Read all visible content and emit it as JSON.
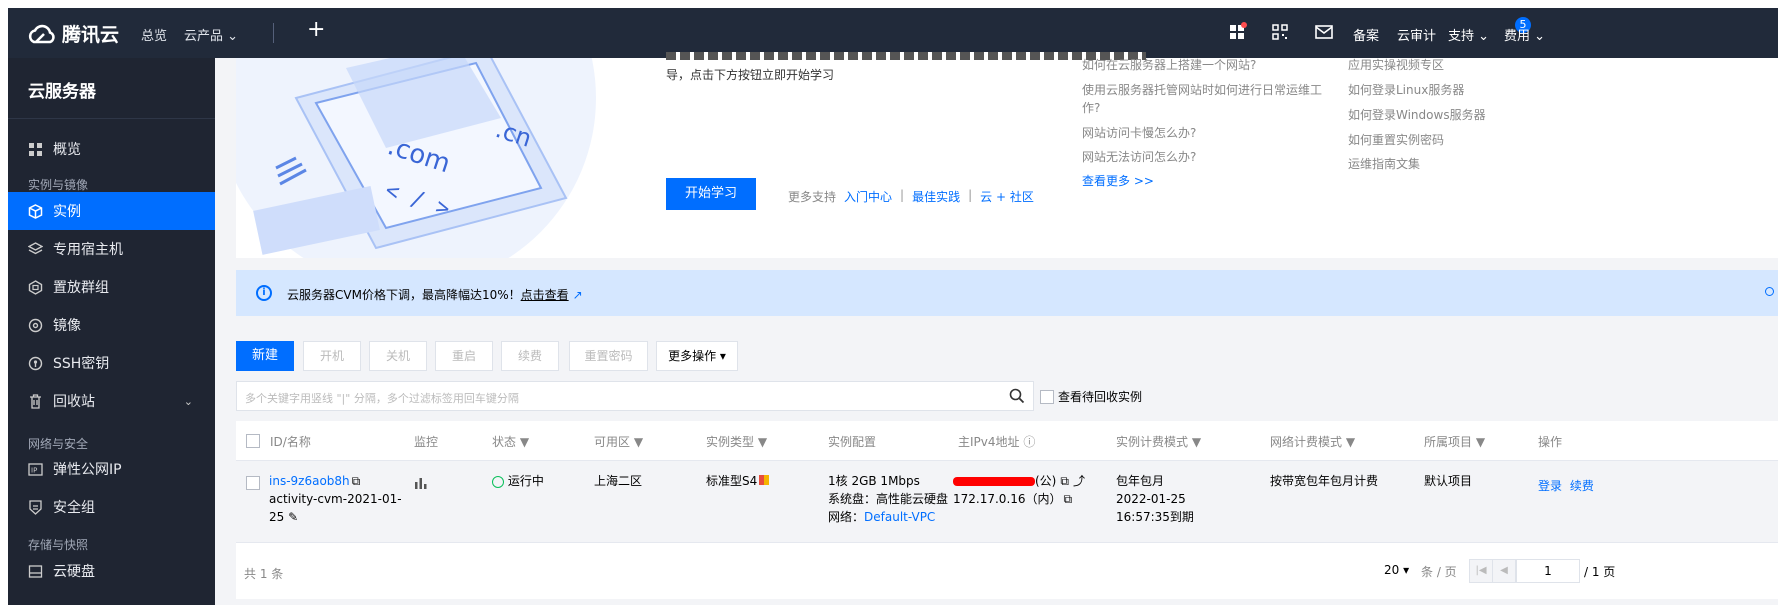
{
  "topnav": {
    "brand": "腾讯云",
    "overview": "总览",
    "products": "云产品",
    "products_caret": "⌄",
    "plus": "+",
    "message_badge": "5",
    "filing": "备案",
    "audit": "云审计",
    "support": "支持",
    "support_caret": "⌄",
    "billing": "费用",
    "billing_caret": "⌄"
  },
  "sidebar": {
    "title": "云服务器",
    "items": [
      {
        "label": "概览",
        "icon": "grid-icon"
      },
      {
        "label": "实例",
        "icon": "cube-icon"
      },
      {
        "label": "专用宿主机",
        "icon": "layers-icon"
      },
      {
        "label": "置放群组",
        "icon": "group-icon"
      },
      {
        "label": "镜像",
        "icon": "disc-icon"
      },
      {
        "label": "SSH密钥",
        "icon": "key-icon"
      },
      {
        "label": "回收站",
        "icon": "trash-icon"
      },
      {
        "label": "弹性公网IP",
        "icon": "ip-icon"
      },
      {
        "label": "安全组",
        "icon": "shield-icon"
      },
      {
        "label": "云硬盘",
        "icon": "disk-icon"
      }
    ],
    "groups": [
      "实例与镜像",
      "网络与安全",
      "存储与快照"
    ],
    "recycle_caret": "⌄"
  },
  "banner": {
    "desc_line2": "导，点击下方按钮立即开始学习",
    "start_button": "开始学习",
    "more_support": "更多支持",
    "links": [
      "入门中心",
      "最佳实践",
      "云 + 社区"
    ],
    "faq_col1": [
      "如何在云服务器上搭建一个网站?",
      "使用云服务器托管网站时如何进行日常运维工",
      "作?",
      "网站访问卡慢怎么办?",
      "网站无法访问怎么办?"
    ],
    "faq_more": "查看更多 >>",
    "faq_col2": [
      "应用实操视频专区",
      "如何登录Linux服务器",
      "如何登录Windows服务器",
      "如何重置实例密码",
      "运维指南文集"
    ],
    "illu_com": ".com",
    "illu_cn": ".cn",
    "illu_code": "< / >"
  },
  "notice": {
    "text": "云服务器CVM价格下调，最高降幅达10%！",
    "link": "点击查看"
  },
  "toolbar": {
    "new": "新建",
    "start": "开机",
    "stop": "关机",
    "restart": "重启",
    "renew": "续费",
    "reset_password": "重置密码",
    "more_ops": "更多操作",
    "more_ops_caret": "▾",
    "search_placeholder": "多个关键字用竖线 \"|\" 分隔，多个过滤标签用回车键分隔",
    "recycle_filter": "查看待回收实例"
  },
  "table": {
    "columns": [
      "ID/名称",
      "监控",
      "状态",
      "可用区",
      "实例类型",
      "实例配置",
      "主IPv4地址",
      "实例计费模式",
      "网络计费模式",
      "所属项目",
      "操作"
    ],
    "row": {
      "id": "ins-9z6aob8h",
      "name_line1": "activity-cvm-2021-01-",
      "name_line2": "25",
      "status": "运行中",
      "zone": "上海二区",
      "type": "标准型S4",
      "config_line1": "1核 2GB 1Mbps",
      "config_line2": "系统盘：高性能云硬盘",
      "config_net_label": "网络：",
      "config_net_value": "Default-VPC",
      "public_suffix": "(公)",
      "private_ip": "172.17.0.16（内）",
      "billing_line1": "包年包月",
      "billing_line2": "2022-01-25",
      "billing_line3": "16:57:35到期",
      "network_billing": "按带宽包年包月计费",
      "project": "默认项目",
      "action_login": "登录",
      "action_renew": "续费"
    },
    "footer": {
      "total": "共 1 条",
      "page_size": "20",
      "page_size_caret": "▾",
      "page_size_unit": "条 / 页",
      "page": "1",
      "page_total": "/ 1 页"
    }
  },
  "colors": {
    "nav_bg": "#212a3a",
    "sidebar_bg": "#1f2532",
    "accent": "#006eff",
    "notice_bg": "#d5e7ff",
    "redaction": "#ff0000",
    "running": "#0abf5b"
  }
}
